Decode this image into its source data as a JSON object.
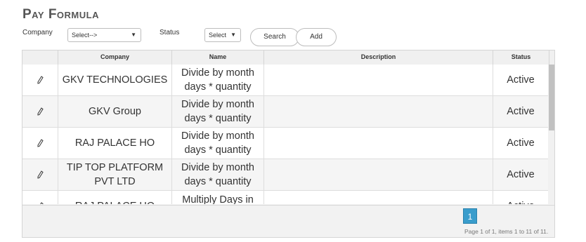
{
  "page": {
    "title": "Pay Formula"
  },
  "filters": {
    "company_label": "Company",
    "company_value": "Select-->",
    "status_label": "Status",
    "status_value": "Select",
    "search_label": "Search",
    "add_label": "Add"
  },
  "grid": {
    "columns": [
      "",
      "Company",
      "Name",
      "Description",
      "Status"
    ],
    "rows": [
      {
        "company": "GKV TECHNOLOGIES",
        "name": "Divide by month days * quantity",
        "description": "",
        "status": "Active"
      },
      {
        "company": "GKV Group",
        "name": "Divide by month days * quantity",
        "description": "",
        "status": "Active"
      },
      {
        "company": "RAJ PALACE HO",
        "name": "Divide by month days * quantity",
        "description": "",
        "status": "Active"
      },
      {
        "company": "TIP TOP PLATFORM PVT LTD",
        "name": "Divide by month days * quantity",
        "description": "",
        "status": "Active"
      },
      {
        "company": "RAJ PALACE HO",
        "name": "Multiply Days in",
        "description": "",
        "status": "Active"
      }
    ],
    "edit_icon": "pencil-icon"
  },
  "pager": {
    "current_page": "1",
    "info": "Page 1 of 1, items 1 to 11 of 11."
  }
}
